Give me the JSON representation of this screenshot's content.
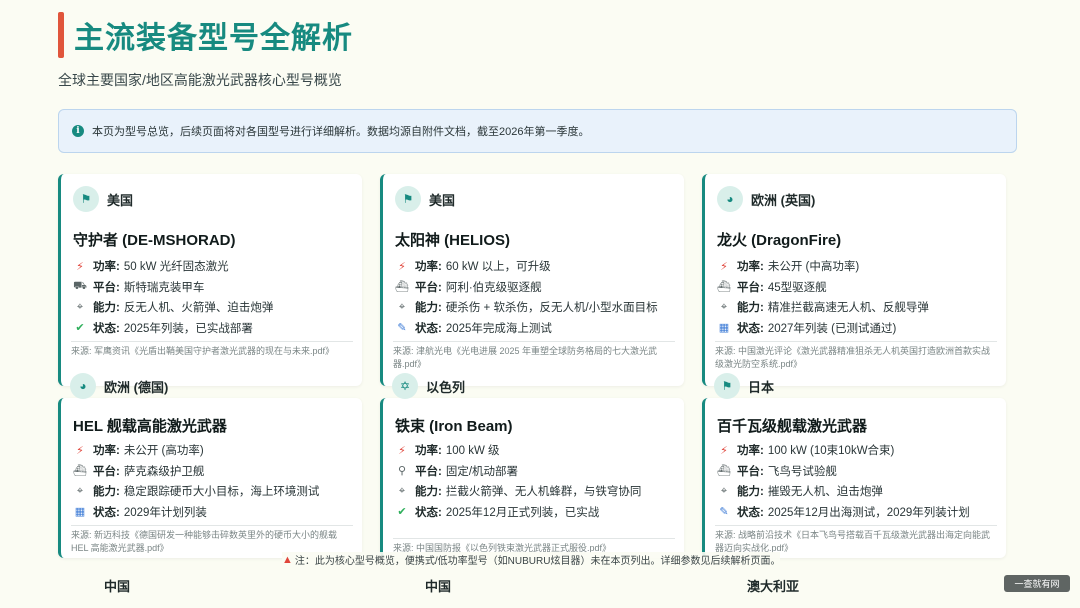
{
  "header": {
    "title": "主流装备型号全解析",
    "subtitle": "全球主要国家/地区高能激光武器核心型号概览"
  },
  "info": {
    "text": "本页为型号总览，后续页面将对各国型号进行详细解析。数据均源自附件文档，截至2026年第一季度。"
  },
  "cards": [
    {
      "region": "美国",
      "badge_icon": "flag-icon",
      "name": "守护者 (DE-MSHORAD)",
      "attrs": [
        {
          "icon": "bolt-icon",
          "key": "功率:",
          "value": "50 kW 光纤固态激光"
        },
        {
          "icon": "truck-icon",
          "key": "平台:",
          "value": "斯特瑞克装甲车"
        },
        {
          "icon": "crosshair-icon",
          "key": "能力:",
          "value": "反无人机、火箭弹、迫击炮弹"
        },
        {
          "icon": "check-circle-icon",
          "key": "状态:",
          "value": "2025年列装，已实战部署"
        }
      ],
      "source": "来源: 军鹰资讯《光盾出鞘美国守护者激光武器的现在与未来.pdf》"
    },
    {
      "region": "美国",
      "badge_icon": "flag-icon",
      "name": "太阳神 (HELIOS)",
      "attrs": [
        {
          "icon": "bolt-icon",
          "key": "功率:",
          "value": "60 kW 以上，可升级"
        },
        {
          "icon": "ship-icon",
          "key": "平台:",
          "value": "阿利·伯克级驱逐舰"
        },
        {
          "icon": "crosshair-icon",
          "key": "能力:",
          "value": "硬杀伤 + 软杀伤，反无人机/小型水面目标"
        },
        {
          "icon": "pencil-icon",
          "key": "状态:",
          "value": "2025年完成海上测试"
        }
      ],
      "source": "来源: 津航光电《光电进展 2025 年重塑全球防务格局的七大激光武器.pdf》"
    },
    {
      "region": "欧洲 (英国)",
      "badge_icon": "globe-icon",
      "name": "龙火 (DragonFire)",
      "attrs": [
        {
          "icon": "bolt-icon",
          "key": "功率:",
          "value": "未公开 (中高功率)"
        },
        {
          "icon": "ship-icon",
          "key": "平台:",
          "value": "45型驱逐舰"
        },
        {
          "icon": "crosshair-icon",
          "key": "能力:",
          "value": "精准拦截高速无人机、反舰导弹"
        },
        {
          "icon": "calendar-icon",
          "key": "状态:",
          "value": "2027年列装 (已测试通过)"
        }
      ],
      "source": "来源: 中国激光评论《激光武器精准狙杀无人机英国打造欧洲首款实战级激光防空系统.pdf》"
    },
    {
      "region": "欧洲 (德国)",
      "badge_icon": "globe-icon",
      "name": "HEL 舰载高能激光武器",
      "attrs": [
        {
          "icon": "bolt-icon",
          "key": "功率:",
          "value": "未公开 (高功率)"
        },
        {
          "icon": "ship-icon",
          "key": "平台:",
          "value": "萨克森级护卫舰"
        },
        {
          "icon": "crosshair-icon",
          "key": "能力:",
          "value": "稳定跟踪硬币大小目标，海上环境测试"
        },
        {
          "icon": "calendar-icon",
          "key": "状态:",
          "value": "2029年计划列装"
        }
      ],
      "source": "来源: 新迈科技《德国研发一种能够击碎数英里外的硬币大小的舰载 HEL 高能激光武器.pdf》"
    },
    {
      "region": "以色列",
      "badge_icon": "star-of-david-icon",
      "name": "铁束 (Iron Beam)",
      "attrs": [
        {
          "icon": "bolt-icon",
          "key": "功率:",
          "value": "100 kW 级"
        },
        {
          "icon": "location-pin-icon",
          "key": "平台:",
          "value": "固定/机动部署"
        },
        {
          "icon": "crosshair-icon",
          "key": "能力:",
          "value": "拦截火箭弹、无人机蜂群，与铁穹协同"
        },
        {
          "icon": "check-circle-icon",
          "key": "状态:",
          "value": "2025年12月正式列装，已实战"
        }
      ],
      "source": "来源: 中国国防报《以色列铁束激光武器正式服役.pdf》"
    },
    {
      "region": "日本",
      "badge_icon": "flag-icon",
      "name": "百千瓦级舰载激光武器",
      "attrs": [
        {
          "icon": "bolt-icon",
          "key": "功率:",
          "value": "100 kW (10束10kW合束)"
        },
        {
          "icon": "ship-icon",
          "key": "平台:",
          "value": "飞鸟号试验舰"
        },
        {
          "icon": "crosshair-icon",
          "key": "能力:",
          "value": "摧毁无人机、迫击炮弹"
        },
        {
          "icon": "pencil-icon",
          "key": "状态:",
          "value": "2025年12月出海测试，2029年列装计划"
        }
      ],
      "source": "来源: 战略前沿技术《日本飞鸟号搭载百千瓦级激光武器出海定向能武器迈向实战化.pdf》"
    }
  ],
  "footnote": "注：此为核心型号概览，便携式/低功率型号（如NUBURU炫目器）未在本页列出。详细参数见后续解析页面。",
  "bottom_regions": [
    "中国",
    "中国",
    "澳大利亚"
  ],
  "watermark": "一查就有网",
  "colors": {
    "accent": "#178a80",
    "title_bar": "#e0553b",
    "background": "#fbfcf3"
  }
}
